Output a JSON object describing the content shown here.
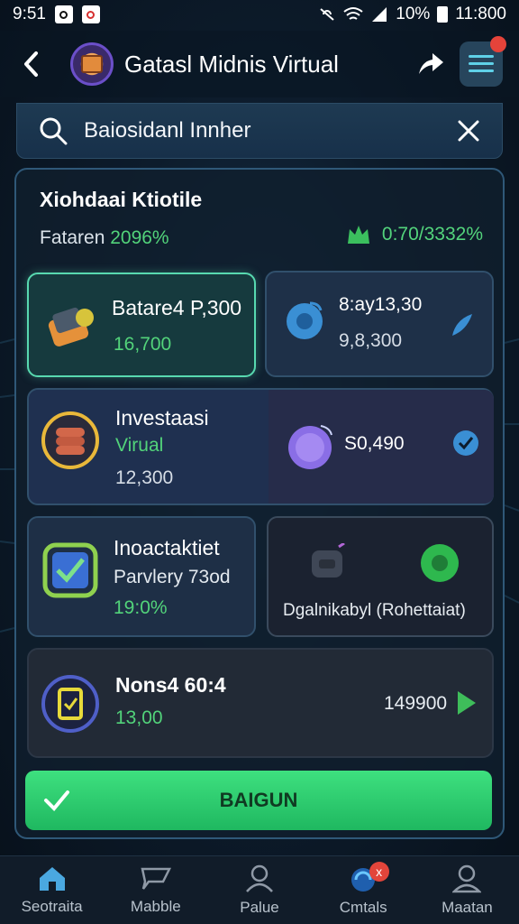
{
  "status_bar": {
    "time": "9:51",
    "battery": "10%",
    "clock": "11:800"
  },
  "header": {
    "title": "Gatasl Midnis Virtual"
  },
  "search": {
    "value": "Baiosidanl Innher"
  },
  "panel": {
    "title": "Xiohdaai Ktiotile",
    "subtitle_label": "Fataren",
    "subtitle_value": "2096%",
    "stat": "0:70/3332%"
  },
  "cards": {
    "top_left": {
      "label": "Batare4 P,300",
      "value": "16,700"
    },
    "top_right": {
      "label": "8:ay13,30",
      "value": "9,8,300"
    },
    "mid_left": {
      "label": "Investaasi",
      "sub": "Virual",
      "value": "12,300"
    },
    "mid_right": {
      "value": "S0,490"
    },
    "row3_left": {
      "label": "Inoactaktiet",
      "sub": "Parvlery 73od",
      "value": "19:0%"
    },
    "row3_right": {
      "label": "Dgalnikabyl (Rohettaiat)"
    },
    "bottom": {
      "label": "Nons4 60:4",
      "value": "13,00",
      "amount": "149900"
    }
  },
  "cta": {
    "label": "BAIGUN"
  },
  "nav": [
    {
      "label": "Seotraita",
      "icon": "home-icon"
    },
    {
      "label": "Mabble",
      "icon": "chat-icon"
    },
    {
      "label": "Palue",
      "icon": "user-icon"
    },
    {
      "label": "Cmtals",
      "icon": "sync-icon",
      "badge": "x"
    },
    {
      "label": "Maatan",
      "icon": "profile-icon"
    }
  ],
  "colors": {
    "accent_green": "#3ee07f",
    "panel_border": "#2f5878",
    "badge_red": "#e5433a"
  }
}
